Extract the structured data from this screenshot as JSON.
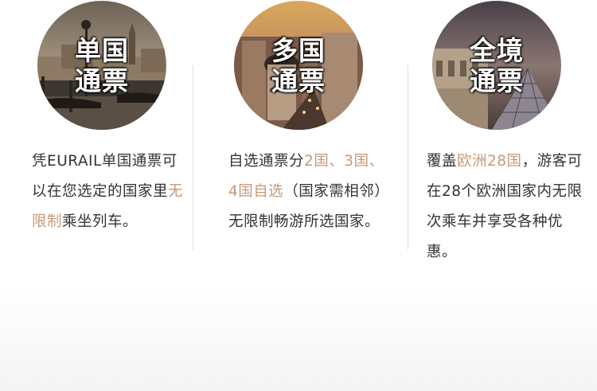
{
  "cards": [
    {
      "title_line1": "单国",
      "title_line2": "通票",
      "desc_a": "凭EURAIL单国通票可以在您选定的国家里",
      "desc_hl": "无限制",
      "desc_b": "乘坐列车。"
    },
    {
      "title_line1": "多国",
      "title_line2": "通票",
      "desc_a": "自选通票分",
      "desc_hl": "2国、3国、4国自选",
      "desc_b": "（国家需相邻）无限制畅游所选国家。"
    },
    {
      "title_line1": "全境",
      "title_line2": "通票",
      "desc_a": "覆盖",
      "desc_hl": "欧洲28国",
      "desc_b": "，游客可在28个欧洲国家内无限次乘车并享受各种优惠。"
    }
  ],
  "colors": {
    "highlight": "#c5997a",
    "text": "#333333",
    "divider": "#e8dfd8"
  }
}
